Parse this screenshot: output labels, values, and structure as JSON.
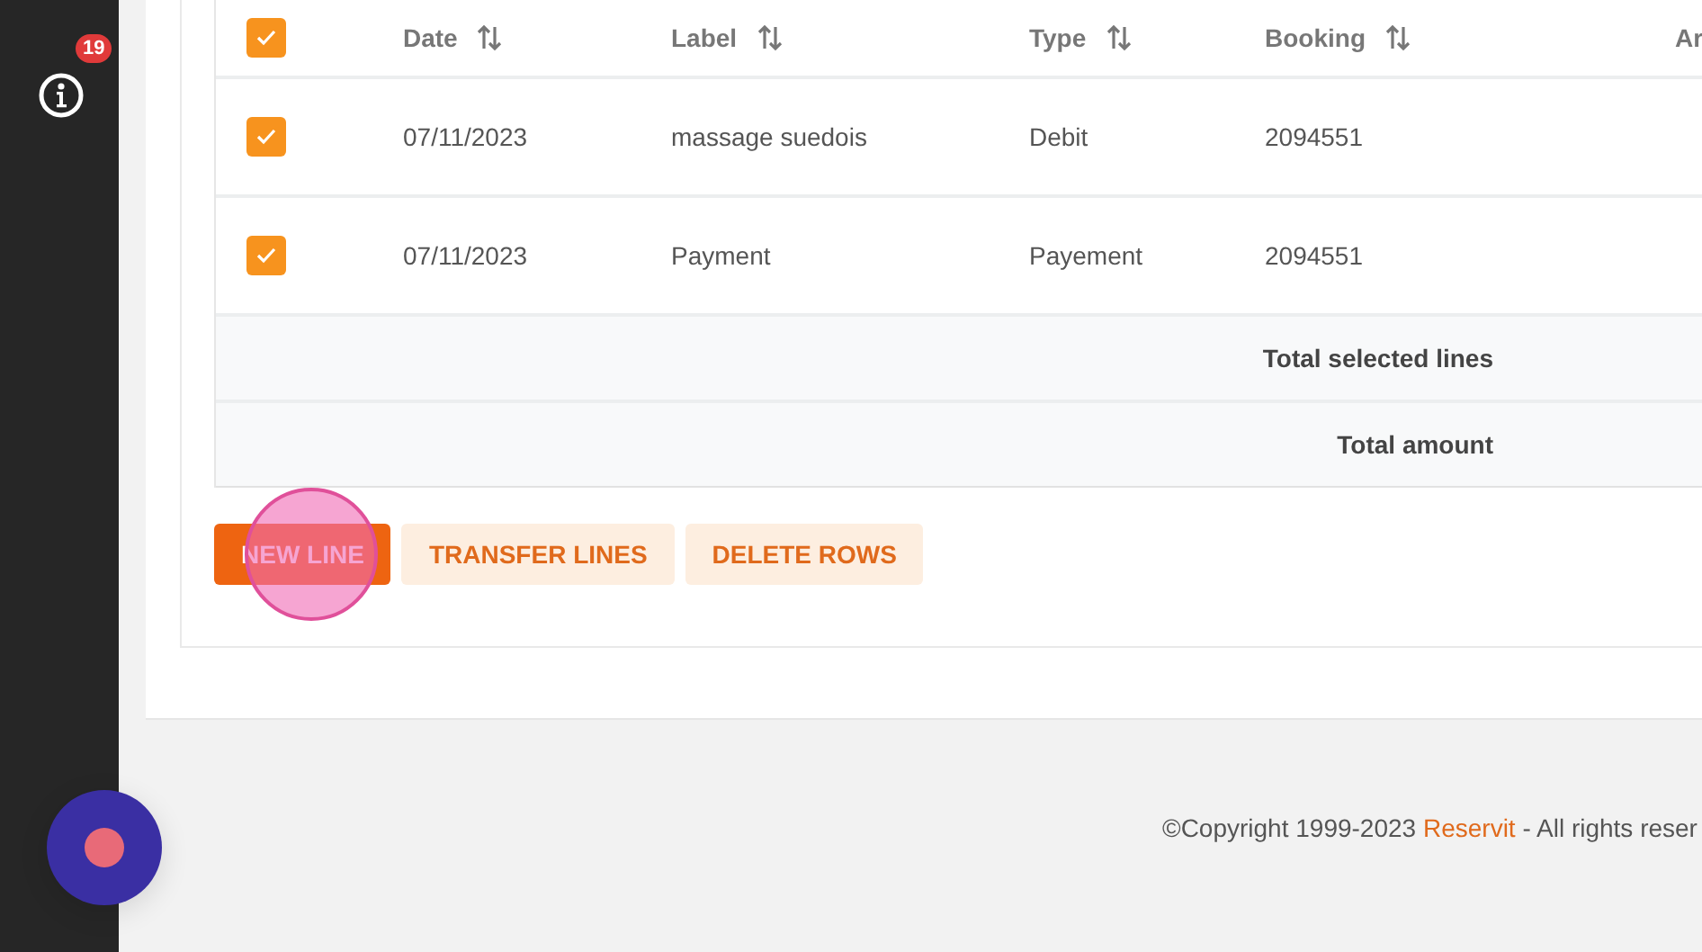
{
  "sidebar": {
    "info_badge": "19"
  },
  "table": {
    "select_all": {
      "checked": true
    },
    "columns": [
      {
        "label": "Date",
        "sortable": true
      },
      {
        "label": "Label",
        "sortable": true
      },
      {
        "label": "Type",
        "sortable": true
      },
      {
        "label": "Booking",
        "sortable": true
      },
      {
        "label": "Ar",
        "sortable": false
      }
    ],
    "rows": [
      {
        "checked": true,
        "cells": [
          "07/11/2023",
          "massage suedois",
          "Debit",
          "2094551"
        ]
      },
      {
        "checked": true,
        "cells": [
          "07/11/2023",
          "Payment",
          "Payement",
          "2094551"
        ]
      }
    ],
    "totals": [
      "Total selected lines",
      "Total amount"
    ]
  },
  "buttons": [
    {
      "label": "NEW LINE",
      "kind": "primary",
      "clicked": true
    },
    {
      "label": "TRANSFER LINES",
      "kind": "soft",
      "clicked": false
    },
    {
      "label": "DELETE ROWS",
      "kind": "soft",
      "clicked": false
    }
  ],
  "footer": {
    "prefix": "©Copyright 1999-2023 ",
    "link": "Reservit",
    "suffix": " - All rights reser"
  }
}
